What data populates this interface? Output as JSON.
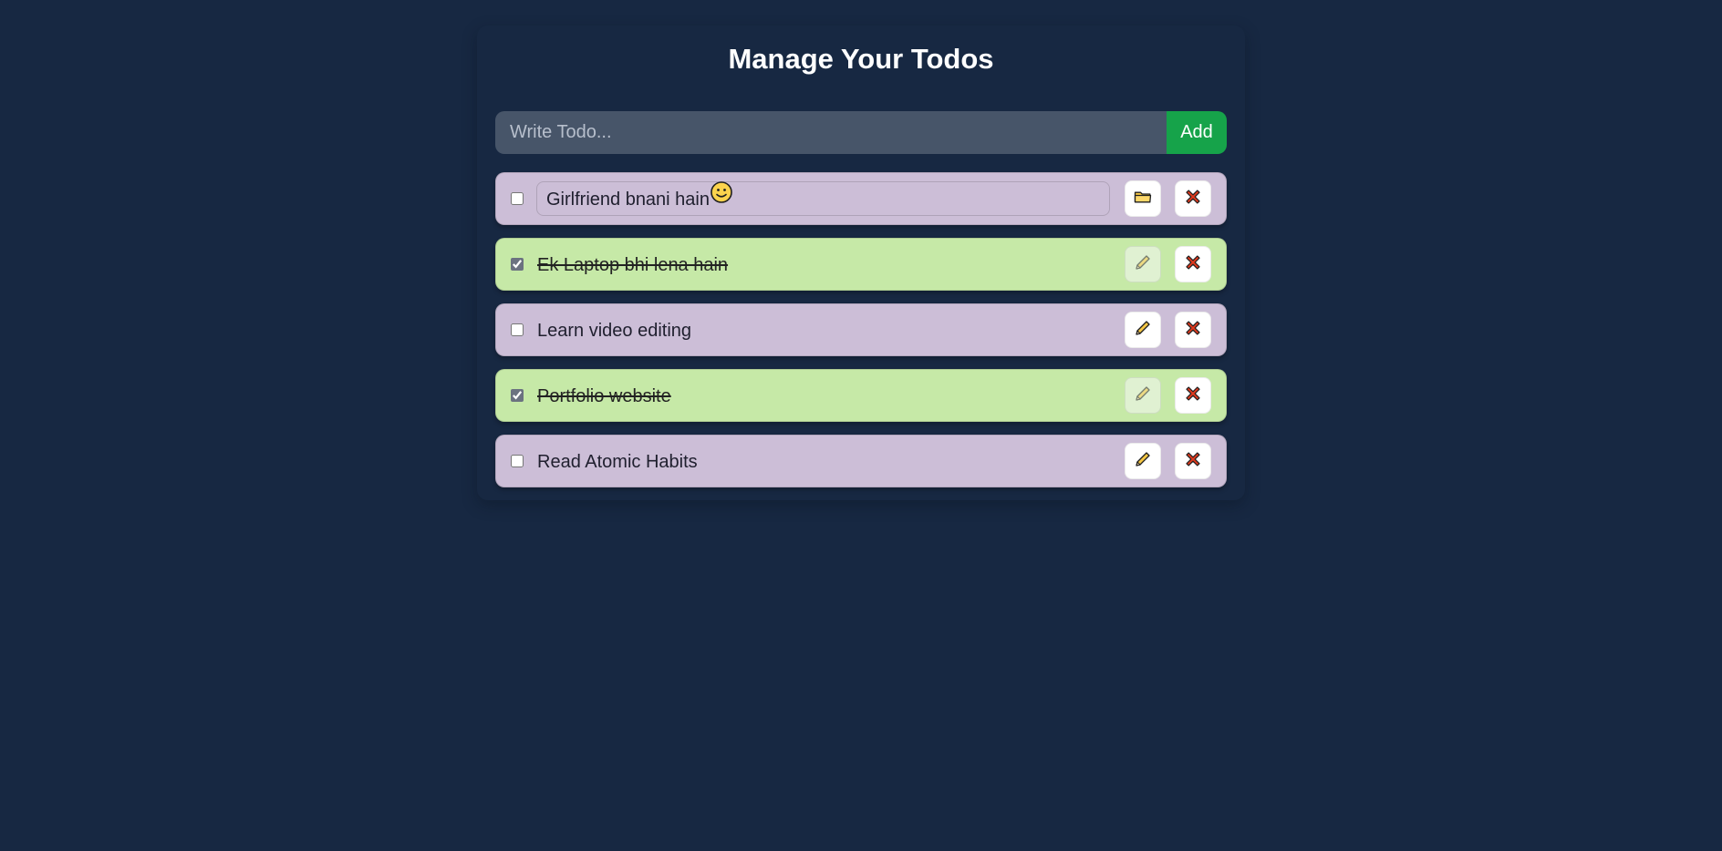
{
  "header": {
    "title": "Manage Your Todos"
  },
  "form": {
    "placeholder": "Write Todo...",
    "add_label": "Add"
  },
  "todos": [
    {
      "text": "Girlfriend bnani hain",
      "emoji": "smiling-face",
      "completed": false,
      "editing": true,
      "action_icon": "folder-icon"
    },
    {
      "text": "Ek Laptop bhi lena hain",
      "completed": true,
      "editing": false,
      "action_icon": "pencil-icon"
    },
    {
      "text": "Learn video editing",
      "completed": false,
      "editing": false,
      "action_icon": "pencil-icon"
    },
    {
      "text": "Portfolio website",
      "completed": true,
      "editing": false,
      "action_icon": "pencil-icon"
    },
    {
      "text": "Read Atomic Habits",
      "completed": false,
      "editing": false,
      "action_icon": "pencil-icon"
    }
  ],
  "colors": {
    "background": "#172842",
    "pending_row": "#ccbed7",
    "completed_row": "#c6e9a7",
    "input_bg": "#475569",
    "add_button": "#16a34a",
    "delete_icon": "#e03a1e"
  }
}
